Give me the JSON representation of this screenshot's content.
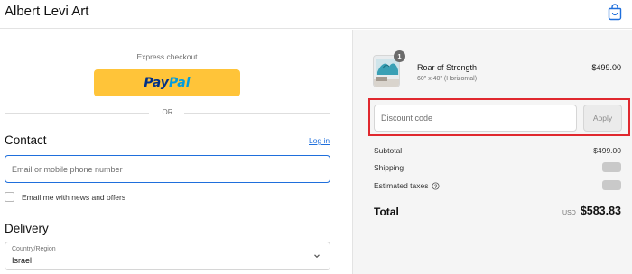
{
  "header": {
    "brand": "Albert Levi Art",
    "cart_icon": "shopping-bag-icon"
  },
  "express": {
    "label": "Express checkout",
    "paypal_part1": "Pay",
    "paypal_part2": "Pal",
    "or_text": "OR"
  },
  "contact": {
    "heading": "Contact",
    "login_link": "Log in",
    "email_placeholder": "Email or mobile phone number",
    "newsletter_label": "Email me with news and offers"
  },
  "delivery": {
    "heading": "Delivery",
    "country_label": "Country/Region",
    "country_value": "Israel"
  },
  "order": {
    "quantity": "1",
    "product_name": "Roar of Strength",
    "product_variant": "60\" x 40\" (Horizontal)",
    "product_price": "$499.00",
    "discount_placeholder": "Discount code",
    "apply_label": "Apply",
    "subtotal_label": "Subtotal",
    "subtotal_value": "$499.00",
    "shipping_label": "Shipping",
    "taxes_label": "Estimated taxes",
    "total_label": "Total",
    "currency": "USD",
    "total_value": "$583.83"
  },
  "colors": {
    "paypal_yellow": "#ffc439",
    "link_blue": "#1f6fdc",
    "highlight_red": "#e0282e"
  }
}
